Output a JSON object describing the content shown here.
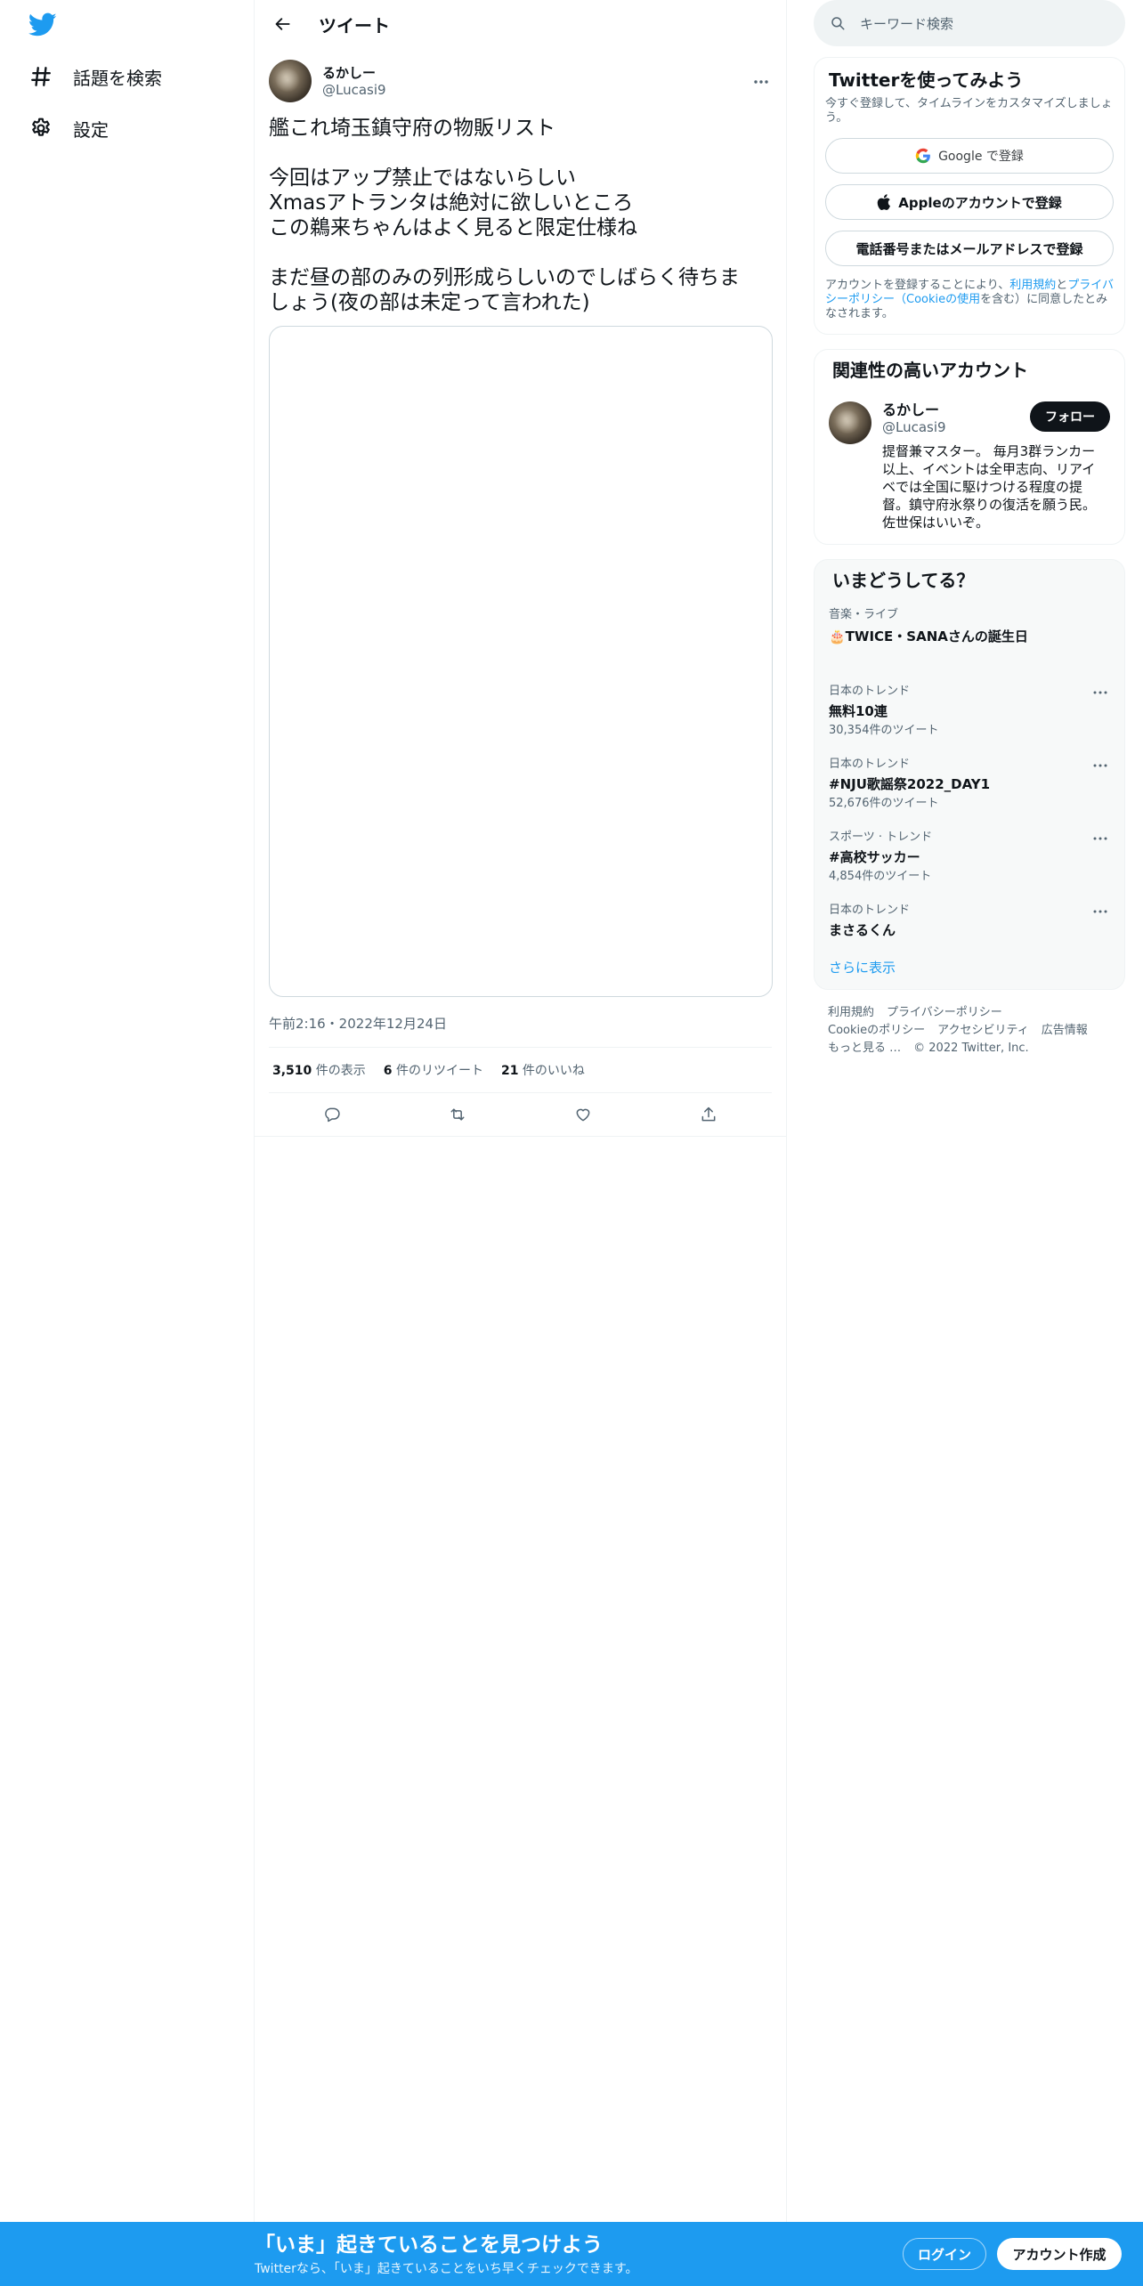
{
  "nav": {
    "logo_icon": "twitter-bird-icon",
    "brand_color": "#1d9bf0",
    "items": [
      {
        "icon": "hashtag-icon",
        "label": "話題を検索"
      },
      {
        "icon": "gear-icon",
        "label": "設定"
      }
    ]
  },
  "header": {
    "back_icon": "arrow-left-icon",
    "title": "ツイート"
  },
  "tweet": {
    "author": {
      "display_name": "るかしー",
      "handle": "@Lucasi9"
    },
    "lines": [
      "艦これ埼玉鎮守府の物販リスト",
      "",
      "今回はアップ禁止ではないらしい",
      "Xmasアトランタは絶対に欲しいところ",
      "この鵜来ちゃんはよく見ると限定仕様ね",
      "",
      "まだ昼の部のみの列形成らしいのでしばらく待ちま",
      "しょう(夜の部は未定って言われた)"
    ],
    "timestamp": "午前2:16・2022年12月24日",
    "stats": [
      {
        "count": "3,510",
        "label": "件の表示"
      },
      {
        "count": "6",
        "label": "件のリツイート"
      },
      {
        "count": "21",
        "label": "件のいいね"
      }
    ],
    "actions": [
      "reply-icon",
      "retweet-icon",
      "like-icon",
      "share-icon"
    ]
  },
  "search": {
    "placeholder": "キーワード検索"
  },
  "signup": {
    "title": "Twitterを使ってみよう",
    "subtitle": "今すぐ登録して、タイムラインをカスタマイズしましょう。",
    "google_button": "Google で登録",
    "apple_button": "Appleのアカウントで登録",
    "phone_button": "電話番号またはメールアドレスで登録",
    "legal_prefix": "アカウントを登録することにより、",
    "legal_terms": "利用規約",
    "legal_and": "と",
    "legal_privacy": "プライバシーポリシー",
    "legal_cookie": "（Cookieの使用",
    "legal_suffix": "を含む）に同意したとみなされます。"
  },
  "related": {
    "title": "関連性の高いアカウント",
    "account": {
      "display_name": "るかしー",
      "handle": "@Lucasi9",
      "bio": "提督兼マスター。 毎月3群ランカー以上、イベントは全甲志向、リアイベでは全国に駆けつける程度の提督。鎮守府氷祭りの復活を願う民。佐世保はいいぞ。",
      "follow_label": "フォロー"
    }
  },
  "trends": {
    "title": "いまどうしてる？",
    "items": [
      {
        "meta": "音楽・ライブ",
        "name": "🎂TWICE・SANAさんの誕生日",
        "count": ""
      },
      {
        "meta": "日本のトレンド",
        "name": "無料10連",
        "count": "30,354件のツイート"
      },
      {
        "meta": "日本のトレンド",
        "name": "#NJU歌謡祭2022_DAY1",
        "count": "52,676件のツイート"
      },
      {
        "meta": "スポーツ · トレンド",
        "name": "#高校サッカー",
        "count": "4,854件のツイート"
      },
      {
        "meta": "日本のトレンド",
        "name": "まさるくん",
        "count": ""
      }
    ],
    "show_more": "さらに表示"
  },
  "footer": {
    "line1": [
      "利用規約",
      "プライバシーポリシー"
    ],
    "line2": [
      "Cookieのポリシー",
      "アクセシビリティ",
      "広告情報"
    ],
    "line3": [
      "もっと見る …",
      "© 2022 Twitter, Inc."
    ]
  },
  "bottom_bar": {
    "title": "「いま」起きていることを見つけよう",
    "subtitle": "Twitterなら、「いま」起きていることをいち早くチェックできます。",
    "login": "ログイン",
    "signup": "アカウント作成"
  }
}
